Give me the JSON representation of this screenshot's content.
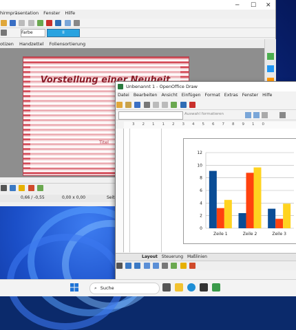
{
  "impress": {
    "title_suffix": "hirmpräsentation",
    "menu": [
      "Fenster",
      "Hilfe"
    ],
    "fill_label": "Farbe",
    "color_label": "II",
    "tabs": [
      "otizen",
      "Handzettel",
      "Foliensortierung"
    ],
    "slide": {
      "title": "Vorstellung einer Neuheit",
      "subtitle": "Titel"
    },
    "status": {
      "position": "0,66 / -0,55",
      "size": "0,00 x 0,00",
      "page_label": "Seite"
    }
  },
  "draw": {
    "title": "Unbenannt 1 - OpenOffice Draw",
    "menu": [
      "Datei",
      "Bearbeiten",
      "Ansicht",
      "Einfügen",
      "Format",
      "Extras",
      "Fenster",
      "Hilfe"
    ],
    "format_placeholder": "Auswahl formatieren",
    "ruler": [
      "3",
      "2",
      "1",
      "1",
      "2",
      "3",
      "4",
      "5",
      "6",
      "7",
      "8",
      "9",
      "10"
    ],
    "tabs": [
      "Layout",
      "Steuerung",
      "Maßlinien"
    ]
  },
  "taskbar": {
    "search_label": "Suche"
  },
  "chart_data": {
    "type": "bar",
    "categories": [
      "Zeile 1",
      "Zeile 2",
      "Zeile 3"
    ],
    "series": [
      {
        "values": [
          9.1,
          2.4,
          3.1
        ],
        "color": "#0a4d96"
      },
      {
        "values": [
          3.2,
          8.8,
          1.5
        ],
        "color": "#ff420e"
      },
      {
        "values": [
          4.5,
          9.65,
          3.9
        ],
        "color": "#ffd320"
      }
    ],
    "ylim": [
      0,
      12
    ],
    "yticks": [
      "0",
      "2",
      "4",
      "6",
      "8",
      "10",
      "12"
    ],
    "grid": true
  }
}
